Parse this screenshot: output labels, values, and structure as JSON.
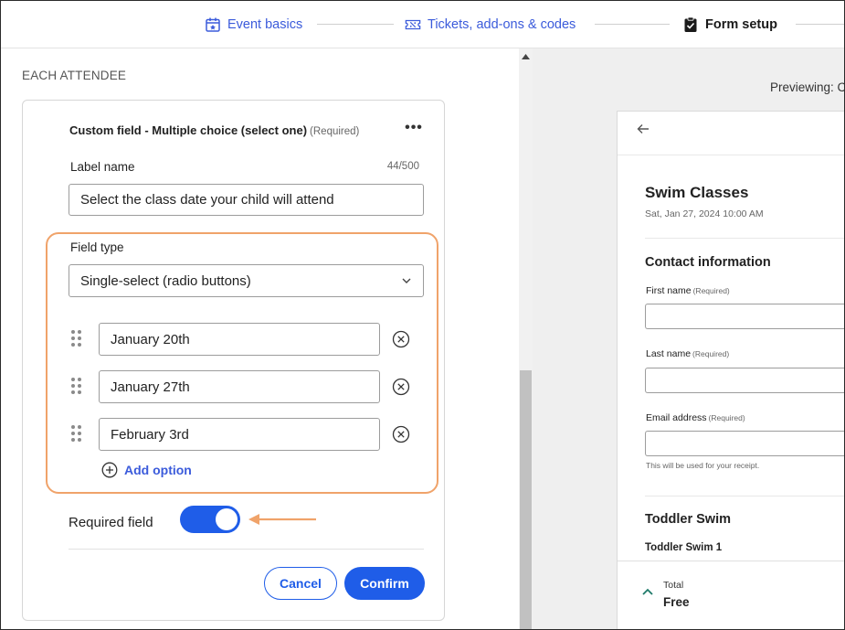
{
  "steps": [
    {
      "label": "Event basics",
      "icon": "calendar-icon",
      "state": "done"
    },
    {
      "label": "Tickets, add-ons & codes",
      "icon": "ticket-icon",
      "state": "done"
    },
    {
      "label": "Form setup",
      "icon": "clipboard-check-icon",
      "state": "active"
    }
  ],
  "editor": {
    "section_label": "EACH ATTENDEE",
    "card_title": "Custom field - Multiple choice (select one)",
    "card_required": "(Required)",
    "more_label": "•••",
    "label_name": {
      "label": "Label name",
      "counter": "44/500",
      "value": "Select the class date your child will attend"
    },
    "field_type": {
      "label": "Field type",
      "value": "Single-select (radio buttons)"
    },
    "options": [
      "January 20th",
      "January 27th",
      "February 3rd"
    ],
    "add_option_label": "Add option",
    "required_field_label": "Required field",
    "required_on": true,
    "cancel_label": "Cancel",
    "confirm_label": "Confirm"
  },
  "preview": {
    "previewing_label": "Previewing: C",
    "event_title": "Swim Classes",
    "event_date": "Sat, Jan 27, 2024 10:00 AM",
    "contact_section": "Contact information",
    "fields": [
      {
        "label": "First name",
        "req": "(Required)"
      },
      {
        "label": "Last name",
        "req": "(Required)"
      },
      {
        "label": "Email address",
        "req": "(Required)"
      }
    ],
    "email_help": "This will be used for your receipt.",
    "ticket_section": "Toddler Swim",
    "ticket_sub": "Toddler Swim 1",
    "total_label": "Total",
    "total_value": "Free"
  },
  "colors": {
    "accent": "#1f5de8",
    "link": "#3b5bdb",
    "highlight": "#f0a36a",
    "preview_bg": "#efefef"
  }
}
